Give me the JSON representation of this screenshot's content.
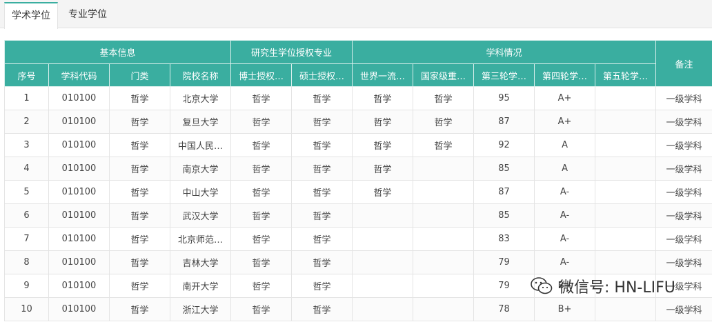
{
  "tabs": [
    {
      "label": "学术学位",
      "active": true
    },
    {
      "label": "专业学位",
      "active": false
    }
  ],
  "table": {
    "groups": {
      "basic": "基本信息",
      "auth": "研究生学位授权专业",
      "discipline": "学科情况",
      "remark": "备注"
    },
    "columns": [
      "序号",
      "学科代码",
      "门类",
      "院校名称",
      "博士授权…",
      "硕士授权…",
      "世界一流…",
      "国家级重…",
      "第三轮学…",
      "第四轮学…",
      "第五轮学…"
    ],
    "rows": [
      {
        "no": "1",
        "code": "010100",
        "category": "哲学",
        "school": "北京大学",
        "phd": "哲学",
        "master": "哲学",
        "world": "哲学",
        "national": "哲学",
        "r3": "95",
        "r4": "A+",
        "r5": "",
        "remark": "一级学科"
      },
      {
        "no": "2",
        "code": "010100",
        "category": "哲学",
        "school": "复旦大学",
        "phd": "哲学",
        "master": "哲学",
        "world": "哲学",
        "national": "哲学",
        "r3": "87",
        "r4": "A+",
        "r5": "",
        "remark": "一级学科"
      },
      {
        "no": "3",
        "code": "010100",
        "category": "哲学",
        "school": "中国人民…",
        "phd": "哲学",
        "master": "哲学",
        "world": "哲学",
        "national": "哲学",
        "r3": "92",
        "r4": "A",
        "r5": "",
        "remark": "一级学科"
      },
      {
        "no": "4",
        "code": "010100",
        "category": "哲学",
        "school": "南京大学",
        "phd": "哲学",
        "master": "哲学",
        "world": "哲学",
        "national": "",
        "r3": "85",
        "r4": "A",
        "r5": "",
        "remark": "一级学科"
      },
      {
        "no": "5",
        "code": "010100",
        "category": "哲学",
        "school": "中山大学",
        "phd": "哲学",
        "master": "哲学",
        "world": "哲学",
        "national": "",
        "r3": "87",
        "r4": "A-",
        "r5": "",
        "remark": "一级学科"
      },
      {
        "no": "6",
        "code": "010100",
        "category": "哲学",
        "school": "武汉大学",
        "phd": "哲学",
        "master": "哲学",
        "world": "",
        "national": "",
        "r3": "85",
        "r4": "A-",
        "r5": "",
        "remark": "一级学科"
      },
      {
        "no": "7",
        "code": "010100",
        "category": "哲学",
        "school": "北京师范…",
        "phd": "哲学",
        "master": "哲学",
        "world": "",
        "national": "",
        "r3": "83",
        "r4": "A-",
        "r5": "",
        "remark": "一级学科"
      },
      {
        "no": "8",
        "code": "010100",
        "category": "哲学",
        "school": "吉林大学",
        "phd": "哲学",
        "master": "哲学",
        "world": "",
        "national": "",
        "r3": "79",
        "r4": "A-",
        "r5": "",
        "remark": "一级学科"
      },
      {
        "no": "9",
        "code": "010100",
        "category": "哲学",
        "school": "南开大学",
        "phd": "哲学",
        "master": "哲学",
        "world": "",
        "national": "",
        "r3": "79",
        "r4": "B+",
        "r5": "",
        "remark": "一级学科"
      },
      {
        "no": "10",
        "code": "010100",
        "category": "哲学",
        "school": "浙江大学",
        "phd": "哲学",
        "master": "哲学",
        "world": "",
        "national": "",
        "r3": "78",
        "r4": "B+",
        "r5": "",
        "remark": "一级学科"
      }
    ]
  },
  "watermark": {
    "text": "微信号: HN-LIFU",
    "icon": "wechat-icon"
  },
  "colors": {
    "header_bg": "#3aaea0",
    "tab_accent": "#3aaea0"
  }
}
